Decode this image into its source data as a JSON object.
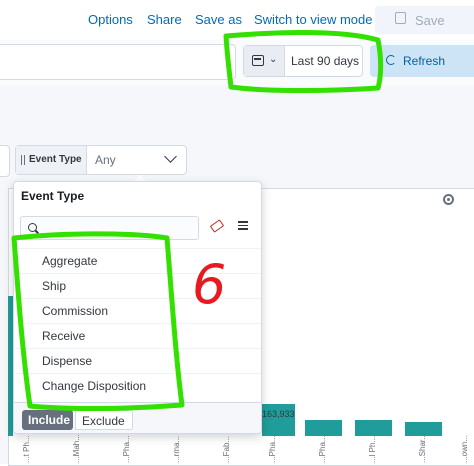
{
  "topnav": {
    "options": "Options",
    "share": "Share",
    "save_as": "Save as",
    "switch_view": "Switch to view mode",
    "save": "Save"
  },
  "toolbar": {
    "date_range": "Last 90 days",
    "refresh": "Refresh"
  },
  "filter": {
    "label": "Event Type",
    "value": "Any"
  },
  "popover": {
    "title": "Event Type",
    "search_placeholder": "",
    "options": [
      "Aggregate",
      "Ship",
      "Commission",
      "Receive",
      "Dispense",
      "Change Disposition"
    ],
    "include": "Include",
    "exclude": "Exclude"
  },
  "chart_data": {
    "type": "bar",
    "bar_color": "#209d9a",
    "visible_value_label": "163,933",
    "tick_labels": [
      "...t Ph...",
      "...Mah...",
      "...Pha...",
      "...rma...",
      "...Fab...",
      "...Pha...",
      "...Pha...",
      "...l Ph...",
      "...Shar...",
      "...own..."
    ]
  },
  "annotations": {
    "handwritten_note": "6",
    "highlight_color": "#33e000",
    "note_color": "#e8191f"
  }
}
